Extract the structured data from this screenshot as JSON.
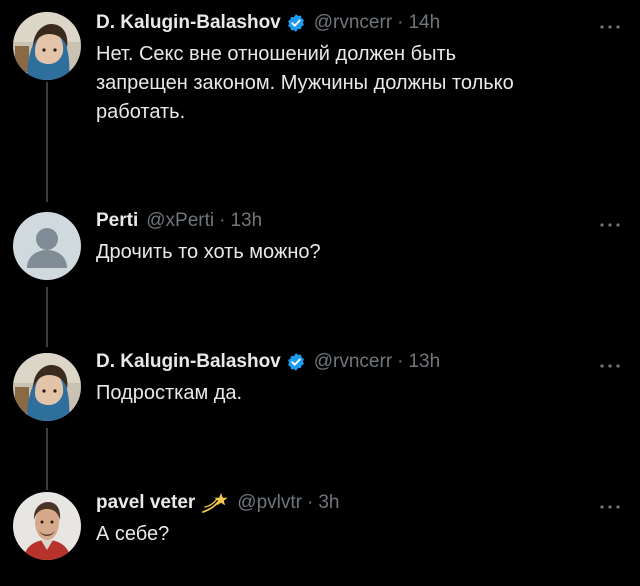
{
  "theme": {
    "background": "#000000",
    "text_color": "#e7e9ea",
    "muted_color": "#71767b",
    "verified_color": "#1d9bf0"
  },
  "tweets": [
    {
      "name": "D. Kalugin-Balashov",
      "handle": "@rvncerr",
      "separator": "·",
      "time": "14h",
      "badge_icon": "verified-badge-icon",
      "text": "Нет. Секс вне отношений должен быть\nзапрещен законом. Мужчины должны только\nработать.",
      "more_icon": "more-options-icon"
    },
    {
      "name": "Perti",
      "handle": "@xPerti",
      "separator": "·",
      "time": "13h",
      "badge_icon": "",
      "text": "Дрочить то хоть можно?",
      "more_icon": "more-options-icon"
    },
    {
      "name": "D. Kalugin-Balashov",
      "handle": "@rvncerr",
      "separator": "·",
      "time": "13h",
      "badge_icon": "verified-badge-icon",
      "text": "Подросткам да.",
      "more_icon": "more-options-icon"
    },
    {
      "name": "pavel veter",
      "handle": "@pvlvtr",
      "separator": "·",
      "time": "3h",
      "badge_icon": "dizzy-emoji-icon",
      "text": "А себе?",
      "more_icon": "more-options-icon"
    }
  ]
}
